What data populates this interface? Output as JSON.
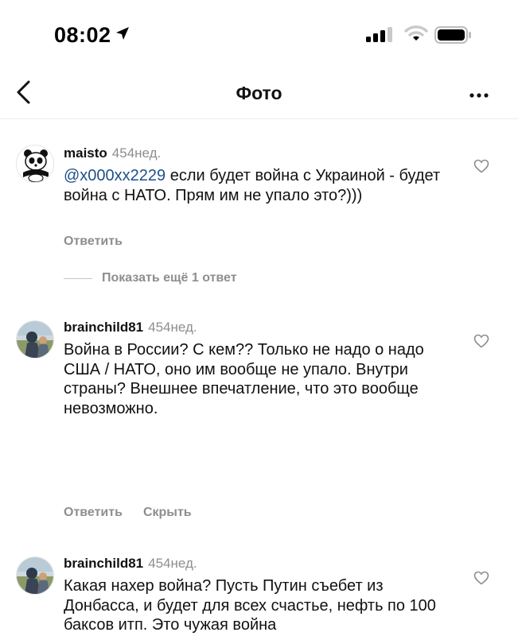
{
  "status_bar": {
    "time": "08:02",
    "icons": [
      "location-arrow-icon",
      "signal-icon",
      "wifi-icon",
      "battery-icon"
    ]
  },
  "nav": {
    "title": "Фото",
    "back_icon": "chevron-left-icon",
    "more_icon": "more-dots-icon"
  },
  "comments": [
    {
      "author": "maisto",
      "time": "454нед.",
      "mention": "@x000xx2229",
      "text": " если будет война с Украиной - будет война с НАТО. Прям им не упало это?)))",
      "actions": [
        "Ответить"
      ]
    },
    {
      "author": "brainchild81",
      "time": "454нед.",
      "text": "Война в России? С кем?? Только не надо о надо США / НАТО, оно им вообще не упало. Внутри страны? Внешнее впечатление, что это вообще невозможно.",
      "actions": [
        "Ответить",
        "Скрыть"
      ]
    },
    {
      "author": "brainchild81",
      "time": "454нед.",
      "text": "Какая нахер война? Пусть Путин съебет из Донбасса, и будет для всех счастье, нефть по 100 баксов итп. Это чужая война"
    }
  ],
  "show_more_replies": "Показать ещё 1 ответ",
  "colors": {
    "text": "#111111",
    "secondary": "#8e8e8e",
    "mention": "#1f4f8b",
    "divider": "#ececec"
  }
}
